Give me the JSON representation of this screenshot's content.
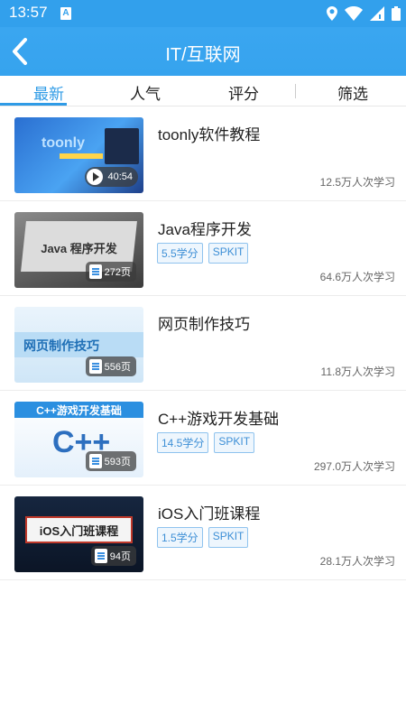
{
  "status": {
    "time": "13:57",
    "notification": "A"
  },
  "header": {
    "title": "IT/互联网",
    "back_icon": "chevron-left-icon"
  },
  "tabs": [
    {
      "label": "最新",
      "active": true
    },
    {
      "label": "人气",
      "active": false
    },
    {
      "label": "评分",
      "active": false
    },
    {
      "label": "筛选",
      "active": false
    }
  ],
  "colors": {
    "accent": "#2f9be6",
    "header": "#36a3ee",
    "tag_border": "#8fc3ee"
  },
  "courses": [
    {
      "title": "toonly软件教程",
      "thumb_label": "toonly",
      "badge": "40:54",
      "badge_type": "video",
      "tags": [],
      "count": "12.5万人次学习"
    },
    {
      "title": "Java程序开发",
      "thumb_label": "Java 程序开发",
      "badge": "272页",
      "badge_type": "doc",
      "tags": [
        "5.5学分",
        "SPKIT"
      ],
      "count": "64.6万人次学习"
    },
    {
      "title": "网页制作技巧",
      "thumb_label": "网页制作技巧",
      "badge": "556页",
      "badge_type": "doc",
      "tags": [],
      "count": "11.8万人次学习"
    },
    {
      "title": "C++游戏开发基础",
      "thumb_label": "C++游戏开发基础",
      "badge": "593页",
      "badge_type": "doc",
      "tags": [
        "14.5学分",
        "SPKIT"
      ],
      "count": "297.0万人次学习"
    },
    {
      "title": "iOS入门班课程",
      "thumb_label": "iOS入门班课程",
      "badge": "94页",
      "badge_type": "doc",
      "tags": [
        "1.5学分",
        "SPKIT"
      ],
      "count": "28.1万人次学习"
    }
  ]
}
